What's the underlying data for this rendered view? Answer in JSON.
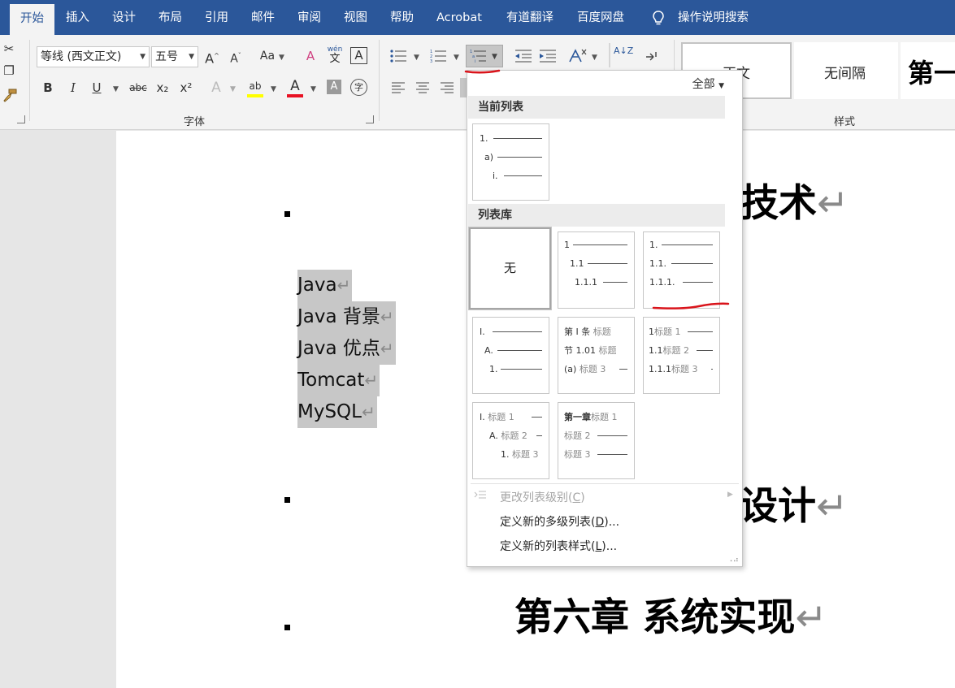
{
  "tabs": [
    "开始",
    "插入",
    "设计",
    "布局",
    "引用",
    "邮件",
    "审阅",
    "视图",
    "帮助",
    "Acrobat",
    "有道翻译",
    "百度网盘",
    "操作说明搜索"
  ],
  "font": {
    "name": "等线 (西文正文)",
    "size": "五号",
    "group_label": "字体",
    "case_label": "Aa",
    "phonetic_label": "wén 文",
    "phonetic_top": "wén",
    "phonetic_bottom": "文",
    "bold": "B",
    "italic": "I",
    "underline": "U",
    "strike": "abc",
    "sub": "x₂",
    "sup": "x²",
    "highlight": "ab",
    "fontcolor": "A",
    "shading": "A",
    "enclose": "字",
    "grow": "A",
    "shrink": "A",
    "clear": "A",
    "border": "A",
    "effects": "A"
  },
  "paragraph": {
    "sort": "A↓Z"
  },
  "styles": {
    "group_label": "样式",
    "items": [
      "正文",
      "无间隔",
      "第一"
    ]
  },
  "colors": {
    "accent": "#2b579a",
    "highlight": "#ffff00",
    "font_color": "#e81123",
    "annotation": "#d9141b"
  },
  "dropdown": {
    "filter": "全部",
    "current_header": "当前列表",
    "library_header": "列表库",
    "current": {
      "l1": "1.",
      "l2": "a)",
      "l3": "i."
    },
    "none_label": "无",
    "t2": {
      "l1": "1",
      "l2": "1.1",
      "l3": "1.1.1"
    },
    "t3": {
      "l1": "1.",
      "l2": "1.1.",
      "l3": "1.1.1."
    },
    "t4": {
      "l1": "I.",
      "l2": "A.",
      "l3": "1."
    },
    "t5": {
      "l1a": "第 I 条",
      "l1b": "标题",
      "l2a": "节 1.01",
      "l2b": "标题",
      "l3a": "(a)",
      "l3b": "标题 3"
    },
    "t6": {
      "l1a": "1",
      "l1b": "标题 1",
      "l2a": "1.1",
      "l2b": "标题 2",
      "l3a": "1.1.1",
      "l3b": "标题 3"
    },
    "t7": {
      "l1a": "I.",
      "l1b": "标题 1",
      "l2a": "A.",
      "l2b": "标题 2",
      "l3a": "1.",
      "l3b": "标题 3"
    },
    "t8": {
      "l1a": "第一章",
      "l1b": "标题 1",
      "l2": "标题 2",
      "l3": "标题 3"
    },
    "menu": {
      "change_level": "更改列表级别",
      "change_level_key": "C",
      "define_multilevel": "定义新的多级列表",
      "define_multilevel_key": "D",
      "define_style": "定义新的列表样式",
      "define_style_key": "L",
      "ellipsis": "..."
    }
  },
  "document": {
    "heading1": "技术",
    "heading2": "统设计",
    "heading3": "第六章 系统实现",
    "return_mark": "↵",
    "list": [
      "Java",
      "Java 背景",
      "Java 优点",
      "Tomcat",
      "MySQL"
    ]
  }
}
